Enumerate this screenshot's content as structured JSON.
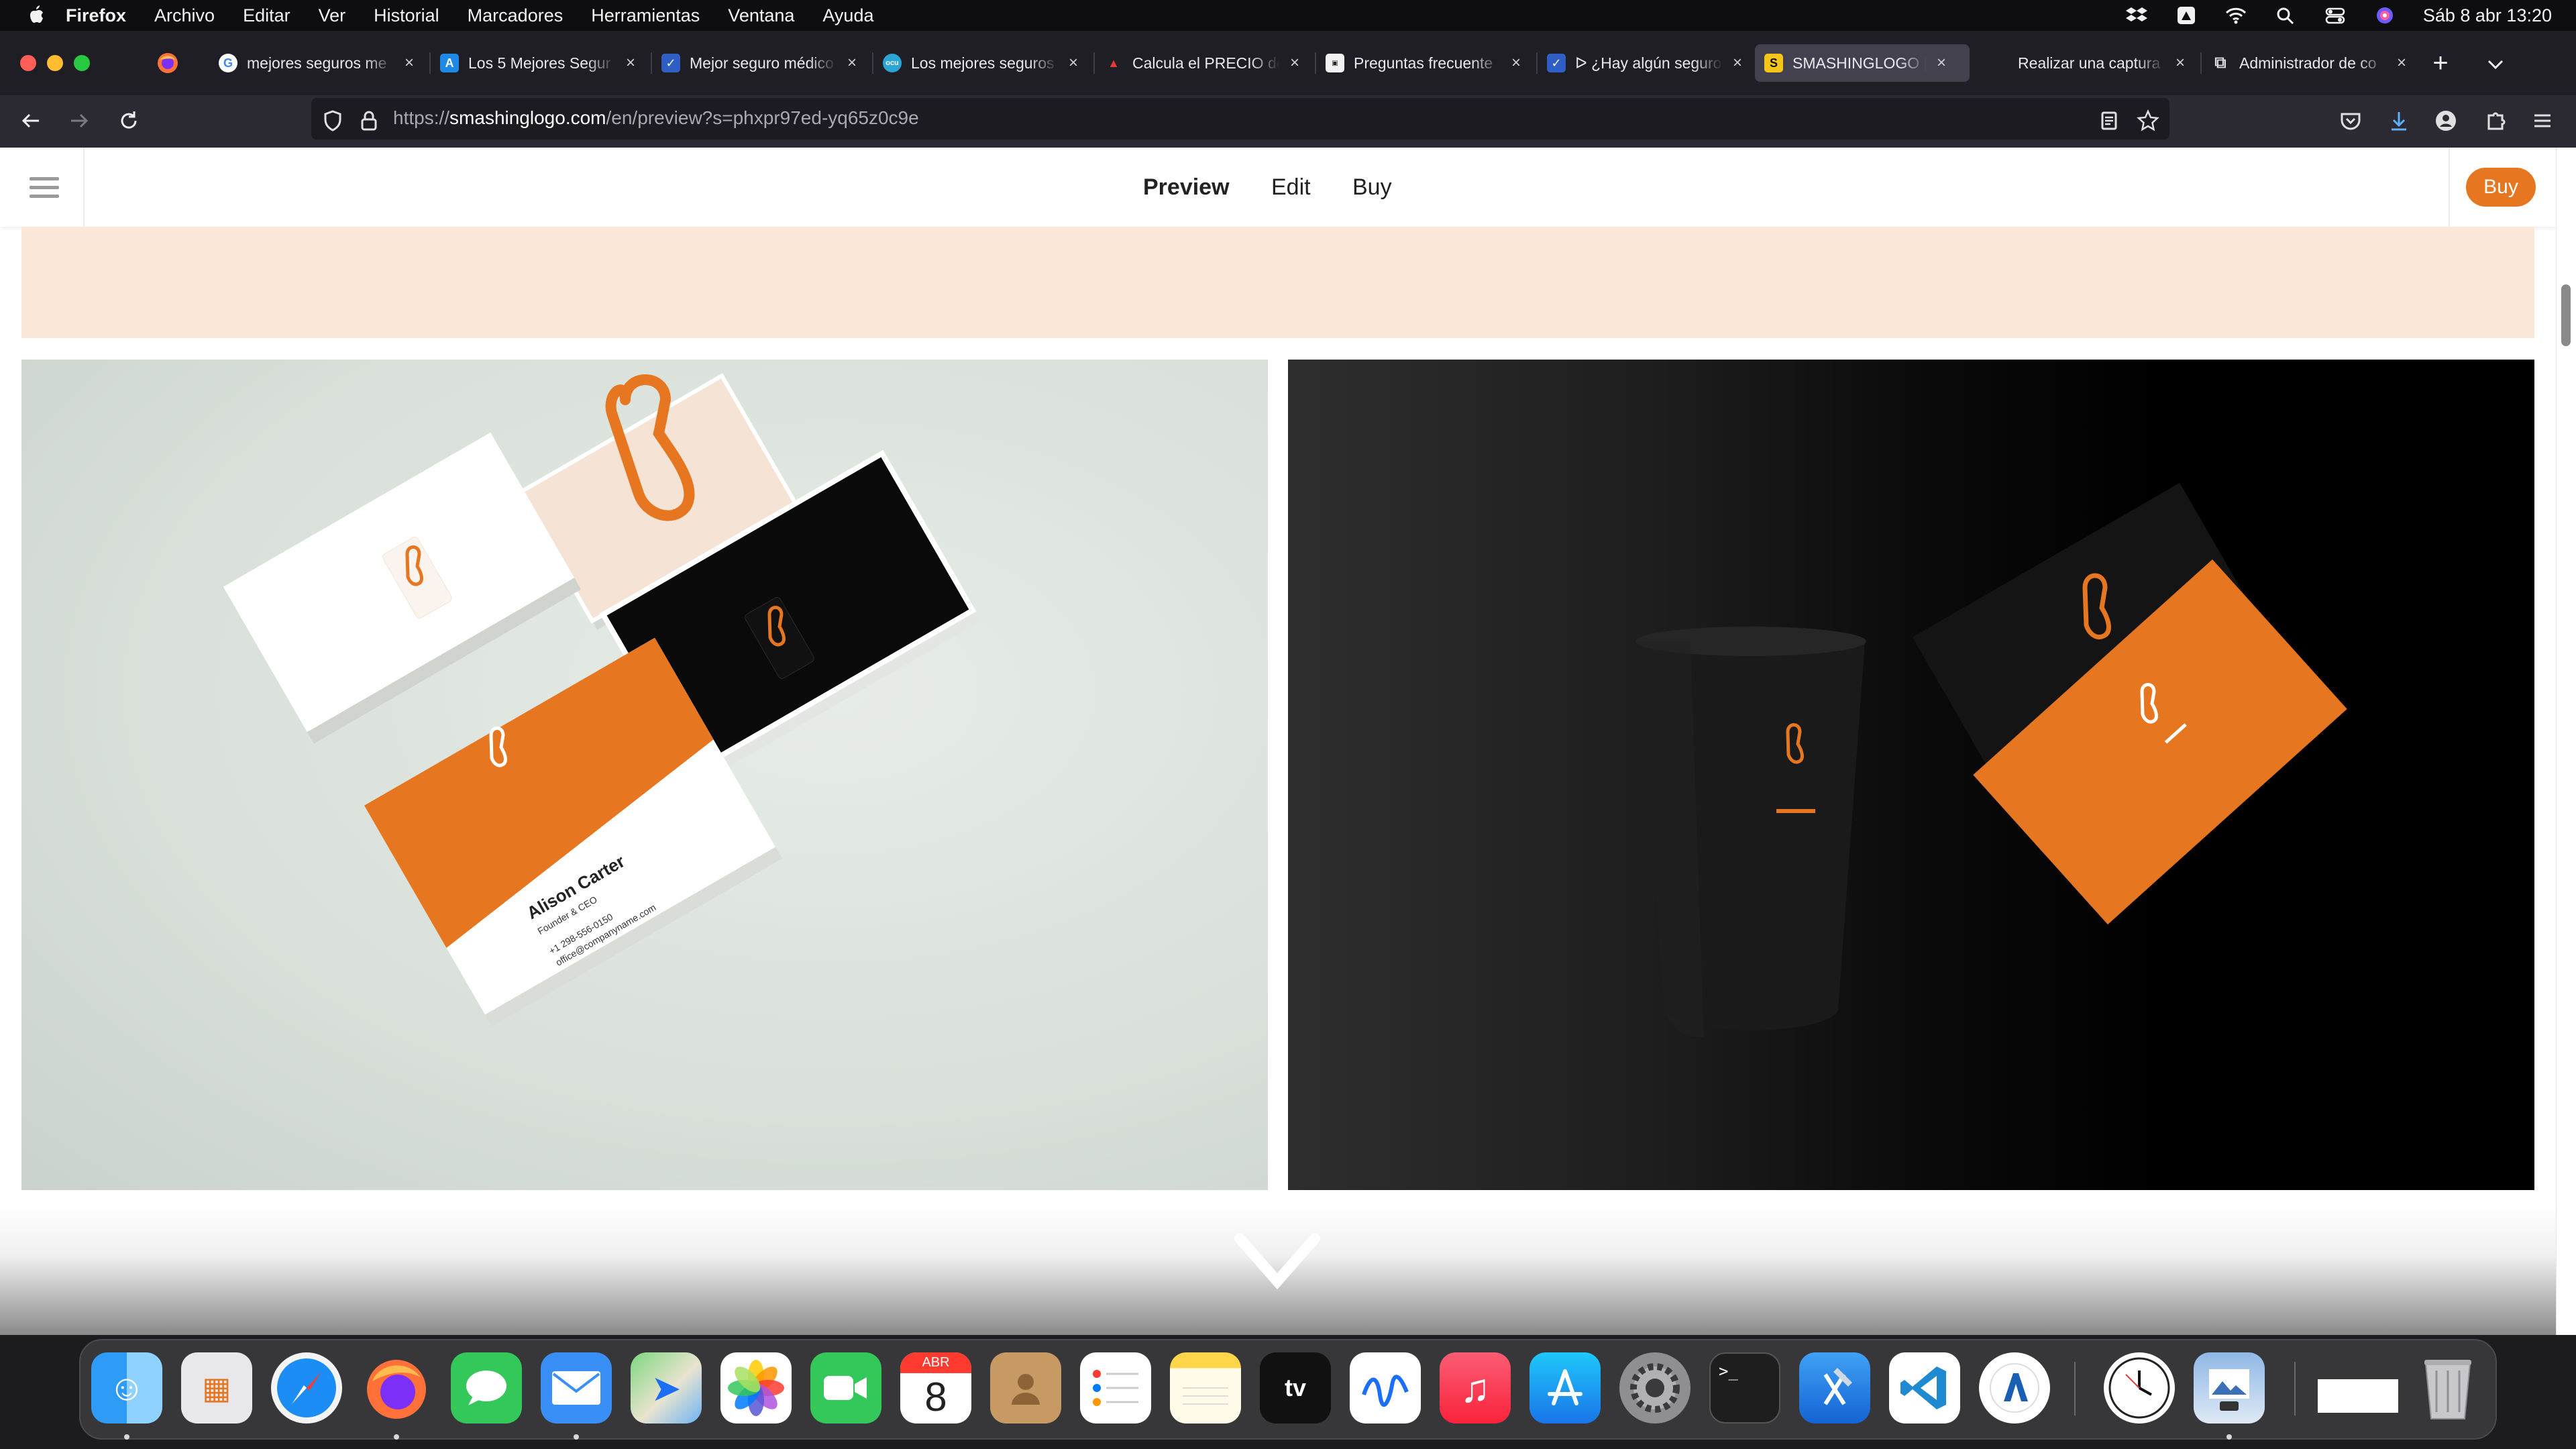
{
  "menubar": {
    "app": "Firefox",
    "items": [
      "Archivo",
      "Editar",
      "Ver",
      "Historial",
      "Marcadores",
      "Herramientas",
      "Ventana",
      "Ayuda"
    ],
    "datetime": "Sáb 8 abr  13:20"
  },
  "tabs": [
    {
      "title": "mejores seguros me",
      "icon": "google-icon"
    },
    {
      "title": "Los 5 Mejores Segur",
      "icon": "letter-a-icon"
    },
    {
      "title": "Mejor seguro médico",
      "icon": "checkmark-icon"
    },
    {
      "title": "Los mejores seguros",
      "icon": "ocu-icon"
    },
    {
      "title": "Calcula el PRECIO de",
      "icon": "red-logo-icon"
    },
    {
      "title": "Preguntas frecuente",
      "icon": "square-logo-icon"
    },
    {
      "title": "ᐅ ¿Hay algún seguro",
      "icon": "checkmark-icon"
    },
    {
      "title": "SMASHINGLOGO | Pr",
      "icon": "smashinglogo-icon",
      "active": true
    },
    {
      "title": "Realizar una captura",
      "icon": "apple-icon"
    },
    {
      "title": "Administrador de co",
      "icon": "puzzle-icon"
    }
  ],
  "toolbar": {
    "url_scheme": "https://",
    "url_host": "smashinglogo.com",
    "url_path": "/en/preview?s=phxpr97ed-yq65z0c9e"
  },
  "site": {
    "nav": {
      "preview": "Preview",
      "edit": "Edit",
      "buy": "Buy"
    },
    "buy_button": "Buy",
    "card_name": "Alison Carter",
    "card_title": "Founder & CEO",
    "card_phone": "+1 298-556-0150",
    "card_email": "office@companyname.com",
    "brand_color": "#e6761f",
    "peach_color": "#fbe8d8"
  },
  "dock": {
    "calendar_month": "ABR",
    "calendar_day": "8",
    "apps": [
      "finder-icon",
      "launchpad-icon",
      "safari-icon",
      "firefox-icon",
      "messages-icon",
      "mail-icon",
      "maps-icon",
      "photos-icon",
      "facetime-icon",
      "calendar-icon",
      "contacts-icon",
      "reminders-icon",
      "notes-icon",
      "appletv-icon",
      "freeform-icon",
      "music-icon",
      "appstore-icon",
      "system-settings-icon",
      "terminal-icon",
      "xcode-icon",
      "vscode-icon",
      "azure-data-studio-icon",
      "clock-icon",
      "preview-icon",
      "firefox-window-thumb",
      "trash-icon"
    ]
  }
}
